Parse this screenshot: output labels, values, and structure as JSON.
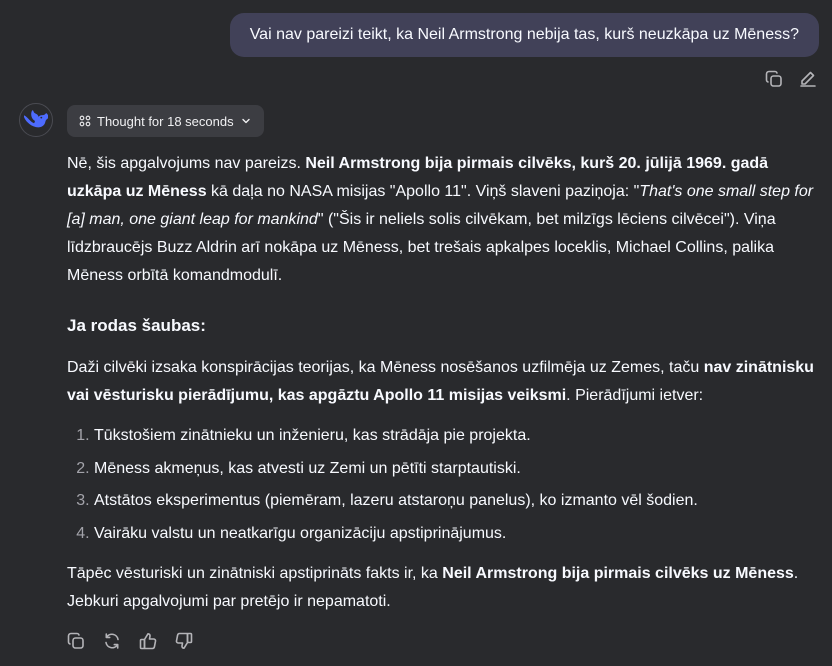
{
  "user_message": "Vai nav pareizi teikt, ka Neil Armstrong nebija tas, kurš neuzkāpa uz Mēness?",
  "icons": {
    "copy": "copy-icon",
    "edit": "edit-icon",
    "thinking": "thinking-icon",
    "chevron": "chevron-down-icon",
    "regenerate": "regenerate-icon",
    "like": "thumbs-up-icon",
    "dislike": "thumbs-down-icon"
  },
  "thought": {
    "label": "Thought for 18 seconds"
  },
  "answer": {
    "p1": {
      "t1": "Nē, šis apgalvojums nav pareizs. ",
      "b1": "Neil Armstrong bija pirmais cilvēks, kurš 20. jūlijā 1969. gadā uzkāpa uz Mēness",
      "t2": " kā daļa no NASA misijas \"Apollo 11\". Viņš slaveni paziņoja: \"",
      "i1": "That's one small step for [a] man, one giant leap for mankind",
      "t3": "\" (\"Šis ir neliels solis cilvēkam, bet milzīgs lēciens cilvēcei\"). Viņa līdzbraucējs Buzz Aldrin arī nokāpa uz Mēness, bet trešais apkalpes loceklis, Michael Collins, palika Mēness orbītā komandmodulī."
    },
    "heading": "Ja rodas šaubas:",
    "p2": {
      "t1": "Daži cilvēki izsaka konspirācijas teorijas, ka Mēness nosēšanos uzfilmēja uz Zemes, taču ",
      "b1": "nav zinātnisku vai vēsturisku pierādījumu, kas apgāztu Apollo 11 misijas veiksmi",
      "t2": ". Pierādījumi ietver:"
    },
    "list": [
      "Tūkstošiem zinātnieku un inženieru, kas strādāja pie projekta.",
      "Mēness akmeņus, kas atvesti uz Zemi un pētīti starptautiski.",
      "Atstātos eksperimentus (piemēram, lazeru atstaroņu panelus), ko izmanto vēl šodien.",
      "Vairāku valstu un neatkarīgu organizāciju apstiprinājumus."
    ],
    "p3": {
      "t1": "Tāpēc vēsturiski un zinātniski apstiprināts fakts ir, ka ",
      "b1": "Neil Armstrong bija pirmais cilvēks uz Mēness",
      "t2": ". Jebkuri apgalvojumi par pretējo ir nepamatoti."
    }
  },
  "colors": {
    "background": "#292a2d",
    "user_bubble": "#414158",
    "accent_logo": "#4d6bfe",
    "text": "#f8faff",
    "muted_icon": "#b4b4b8"
  }
}
